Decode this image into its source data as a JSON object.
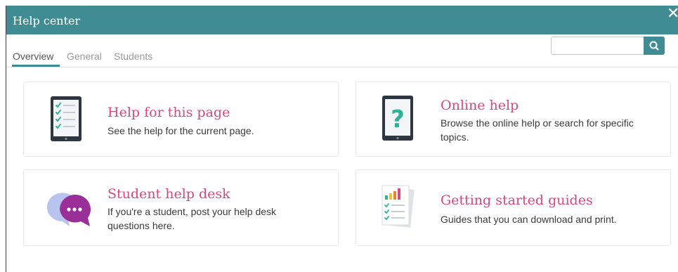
{
  "dialog": {
    "title": "Help center",
    "close_symbol": "✕"
  },
  "tabs": [
    {
      "label": "Overview",
      "active": true
    },
    {
      "label": "General",
      "active": false
    },
    {
      "label": "Students",
      "active": false
    }
  ],
  "search": {
    "placeholder": "",
    "value": "",
    "icon": "search-icon"
  },
  "cards": [
    {
      "icon": "tablet-checklist-icon",
      "title": "Help for this page",
      "description": "See the help for the current page."
    },
    {
      "icon": "tablet-question-icon",
      "title": "Online help",
      "description": "Browse the online help or search for specific topics."
    },
    {
      "icon": "chat-bubbles-icon",
      "title": "Student help desk",
      "description": "If you're a student, post your help desk questions here."
    },
    {
      "icon": "document-chart-icon",
      "title": "Getting started guides",
      "description": "Guides that you can download and print."
    }
  ],
  "colors": {
    "accent": "#3f8d93",
    "title_pink": "#d6487e"
  }
}
